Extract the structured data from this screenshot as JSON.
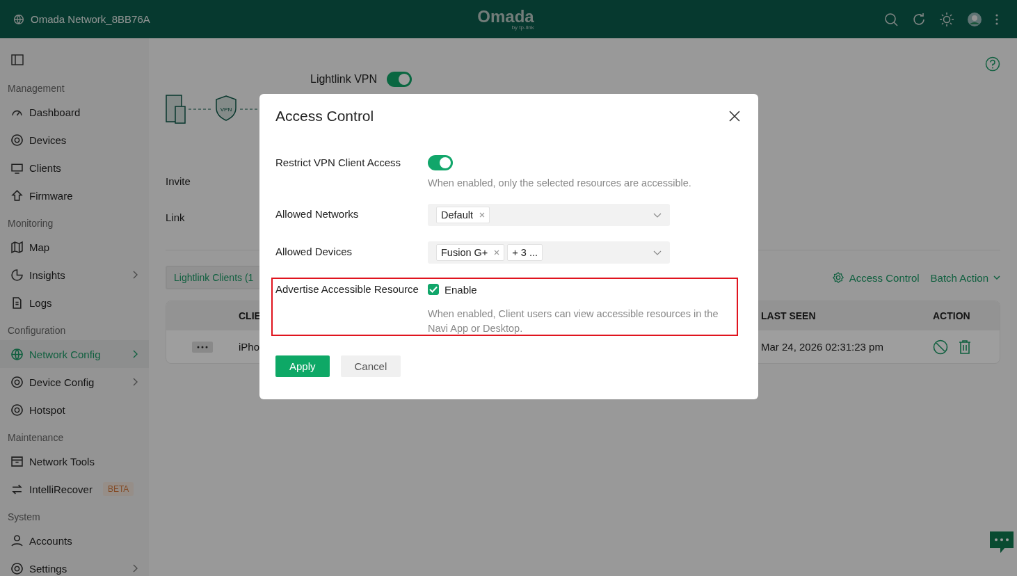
{
  "header": {
    "site": "Omada Network_8BB76A",
    "logo": "Omada",
    "logo_sub": "by tp-link"
  },
  "sidebar": {
    "sections": [
      {
        "heading": "Management",
        "items": [
          {
            "label": "Dashboard",
            "selected": false,
            "expandable": false
          },
          {
            "label": "Devices",
            "selected": false,
            "expandable": false
          },
          {
            "label": "Clients",
            "selected": false,
            "expandable": false
          },
          {
            "label": "Firmware",
            "selected": false,
            "expandable": false
          }
        ]
      },
      {
        "heading": "Monitoring",
        "items": [
          {
            "label": "Map",
            "selected": false,
            "expandable": false
          },
          {
            "label": "Insights",
            "selected": false,
            "expandable": true
          },
          {
            "label": "Logs",
            "selected": false,
            "expandable": false
          }
        ]
      },
      {
        "heading": "Configuration",
        "items": [
          {
            "label": "Network Config",
            "selected": true,
            "expandable": true
          },
          {
            "label": "Device Config",
            "selected": false,
            "expandable": true
          },
          {
            "label": "Hotspot",
            "selected": false,
            "expandable": false
          }
        ]
      },
      {
        "heading": "Maintenance",
        "items": [
          {
            "label": "Network Tools",
            "selected": false,
            "expandable": false
          },
          {
            "label": "IntelliRecover",
            "selected": false,
            "expandable": false,
            "badge": "BETA"
          }
        ]
      },
      {
        "heading": "System",
        "items": [
          {
            "label": "Accounts",
            "selected": false,
            "expandable": false
          },
          {
            "label": "Settings",
            "selected": false,
            "expandable": true
          }
        ]
      }
    ]
  },
  "page": {
    "diagram_label": "VPN",
    "vpn": {
      "label": "Lightlink VPN",
      "on": true
    },
    "fields": [
      "Invite",
      "Link"
    ],
    "tab": "Lightlink Clients (1",
    "actions": [
      "Access Control",
      "Batch Action"
    ],
    "table": {
      "columns": [
        "CLIE",
        "LAST SEEN",
        "ACTION"
      ],
      "rows": [
        {
          "name": "iPho",
          "last_seen": "Mar 24, 2026 02:31:23 pm"
        }
      ]
    }
  },
  "modal": {
    "title": "Access Control",
    "rows": [
      {
        "kind": "toggle",
        "label": "Restrict VPN Client Access",
        "on": true,
        "hint": "When enabled, only the selected resources are accessible."
      },
      {
        "kind": "select",
        "label": "Allowed Networks",
        "tags": [
          "Default"
        ],
        "more": null
      },
      {
        "kind": "select",
        "label": "Allowed Devices",
        "tags": [
          "Fusion G+"
        ],
        "more": "+ 3 ..."
      },
      {
        "kind": "checkbox",
        "label": "Advertise Accessible Resource",
        "option": "Enable",
        "checked": true,
        "hint": "When enabled, Client users can view accessible resources in the Navi App or Desktop."
      }
    ],
    "buttons": [
      {
        "label": "Apply",
        "kind": "primary"
      },
      {
        "label": "Cancel",
        "kind": "secondary"
      }
    ]
  }
}
